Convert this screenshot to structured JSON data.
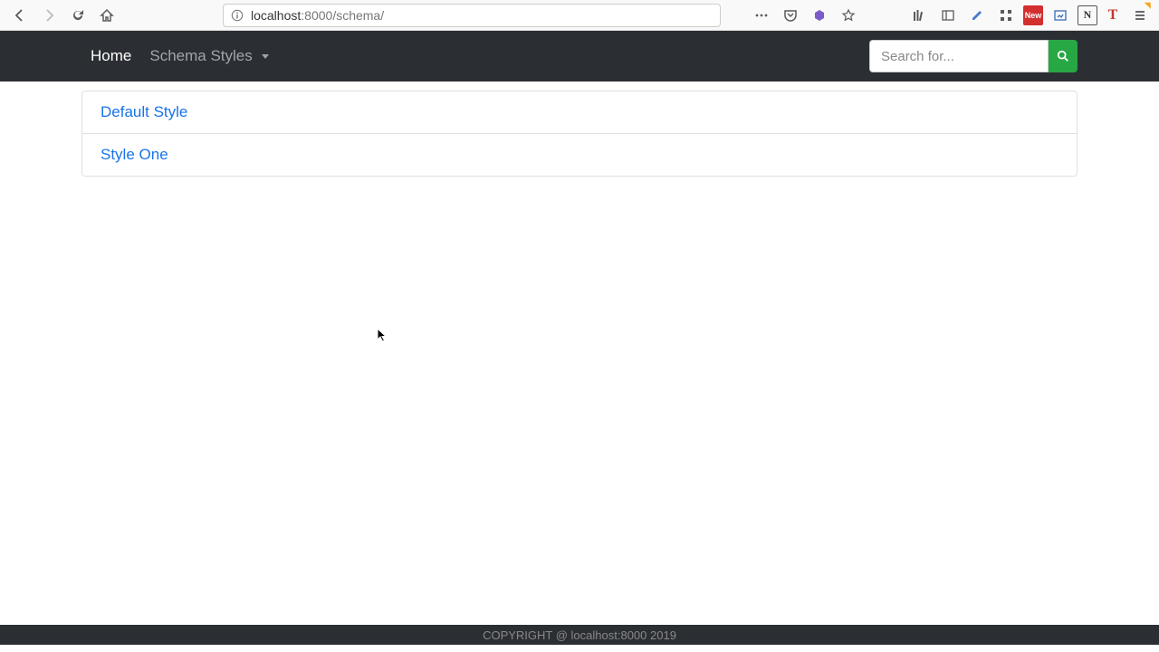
{
  "browser": {
    "url_host": "localhost",
    "url_port": ":8000",
    "url_path": "/schema/"
  },
  "navbar": {
    "home": "Home",
    "dropdown": "Schema Styles",
    "search_placeholder": "Search for..."
  },
  "list": {
    "items": [
      "Default Style",
      "Style One"
    ]
  },
  "footer": {
    "text": "COPYRIGHT @ localhost:8000 2019"
  },
  "extensions": {
    "new_badge": "New",
    "n_letter": "N",
    "t_letter": "T"
  }
}
